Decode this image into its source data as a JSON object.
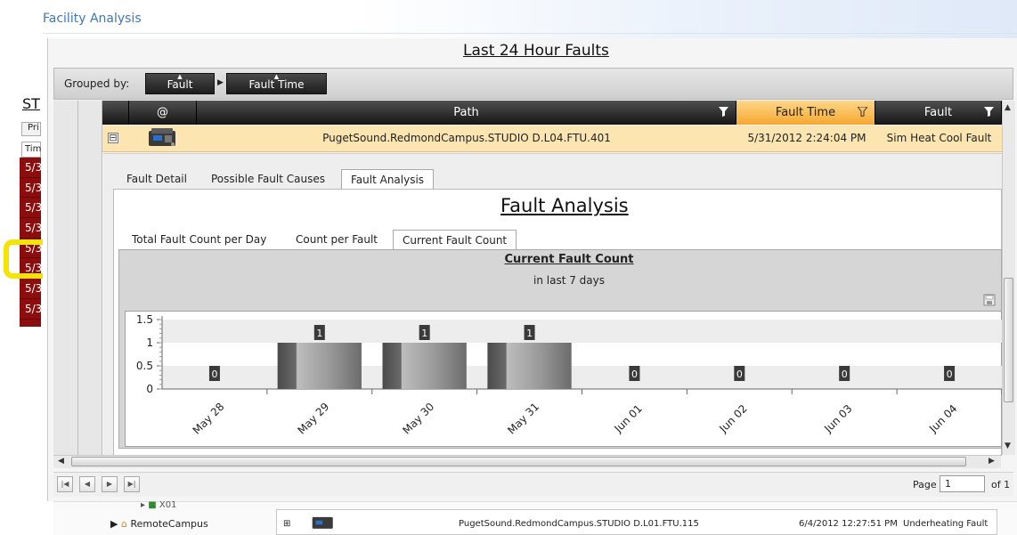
{
  "app": {
    "title": "Facility Analysis"
  },
  "left_panel": {
    "heading": "ST",
    "button": "Pri",
    "column": "Tim",
    "rows": [
      "5/3",
      "5/3",
      "5/3",
      "5/3",
      "5/3",
      "5/3",
      "5/3",
      "5/3"
    ]
  },
  "panel": {
    "title": "Last 24 Hour Faults"
  },
  "grouping": {
    "label": "Grouped by:",
    "chips": [
      "Fault",
      "Fault Time"
    ]
  },
  "grid": {
    "columns": {
      "at": "@",
      "path": "Path",
      "fault_time": "Fault Time",
      "fault": "Fault"
    },
    "selected_row": {
      "expander": "⊟",
      "path": "PugetSound.RedmondCampus.STUDIO D.L04.FTU.401",
      "fault_time": "5/31/2012 2:24:04 PM",
      "fault": "Sim Heat Cool Fault"
    }
  },
  "detail_tabs": [
    "Fault Detail",
    "Possible Fault Causes",
    "Fault Analysis"
  ],
  "fault_analysis": {
    "title": "Fault Analysis",
    "subtabs": [
      "Total Fault Count per Day",
      "Count per Fault",
      "Current Fault Count"
    ]
  },
  "chart_data": {
    "type": "bar",
    "title": "Current Fault Count",
    "subtitle": "in last 7 days",
    "categories": [
      "May 28",
      "May 29",
      "May 30",
      "May 31",
      "Jun 01",
      "Jun 02",
      "Jun 03",
      "Jun 04"
    ],
    "values": [
      0,
      1,
      1,
      1,
      0,
      0,
      0,
      0
    ],
    "ylim": [
      0,
      1.5
    ],
    "yticks": [
      "0",
      "0.5",
      "1",
      "1.5"
    ],
    "data_labels": true
  },
  "pager": {
    "page_label": "Page",
    "page_value": "1",
    "of_label": "of 1"
  },
  "background": {
    "tree_fragment": "X01",
    "tree_item": "RemoteCampus",
    "row": {
      "expander": "⊞",
      "path": "PugetSound.RedmondCampus.STUDIO D.L01.FTU.115",
      "time": "6/4/2012 12:27:51 PM",
      "fault": "Underheating Fault"
    }
  },
  "colors": {
    "accent": "#f5a830",
    "header_dark": "#1d1d1d",
    "selected_row": "#fde5b2",
    "alarm_rows": "#8b0d0d",
    "highlight": "#f5e400"
  }
}
